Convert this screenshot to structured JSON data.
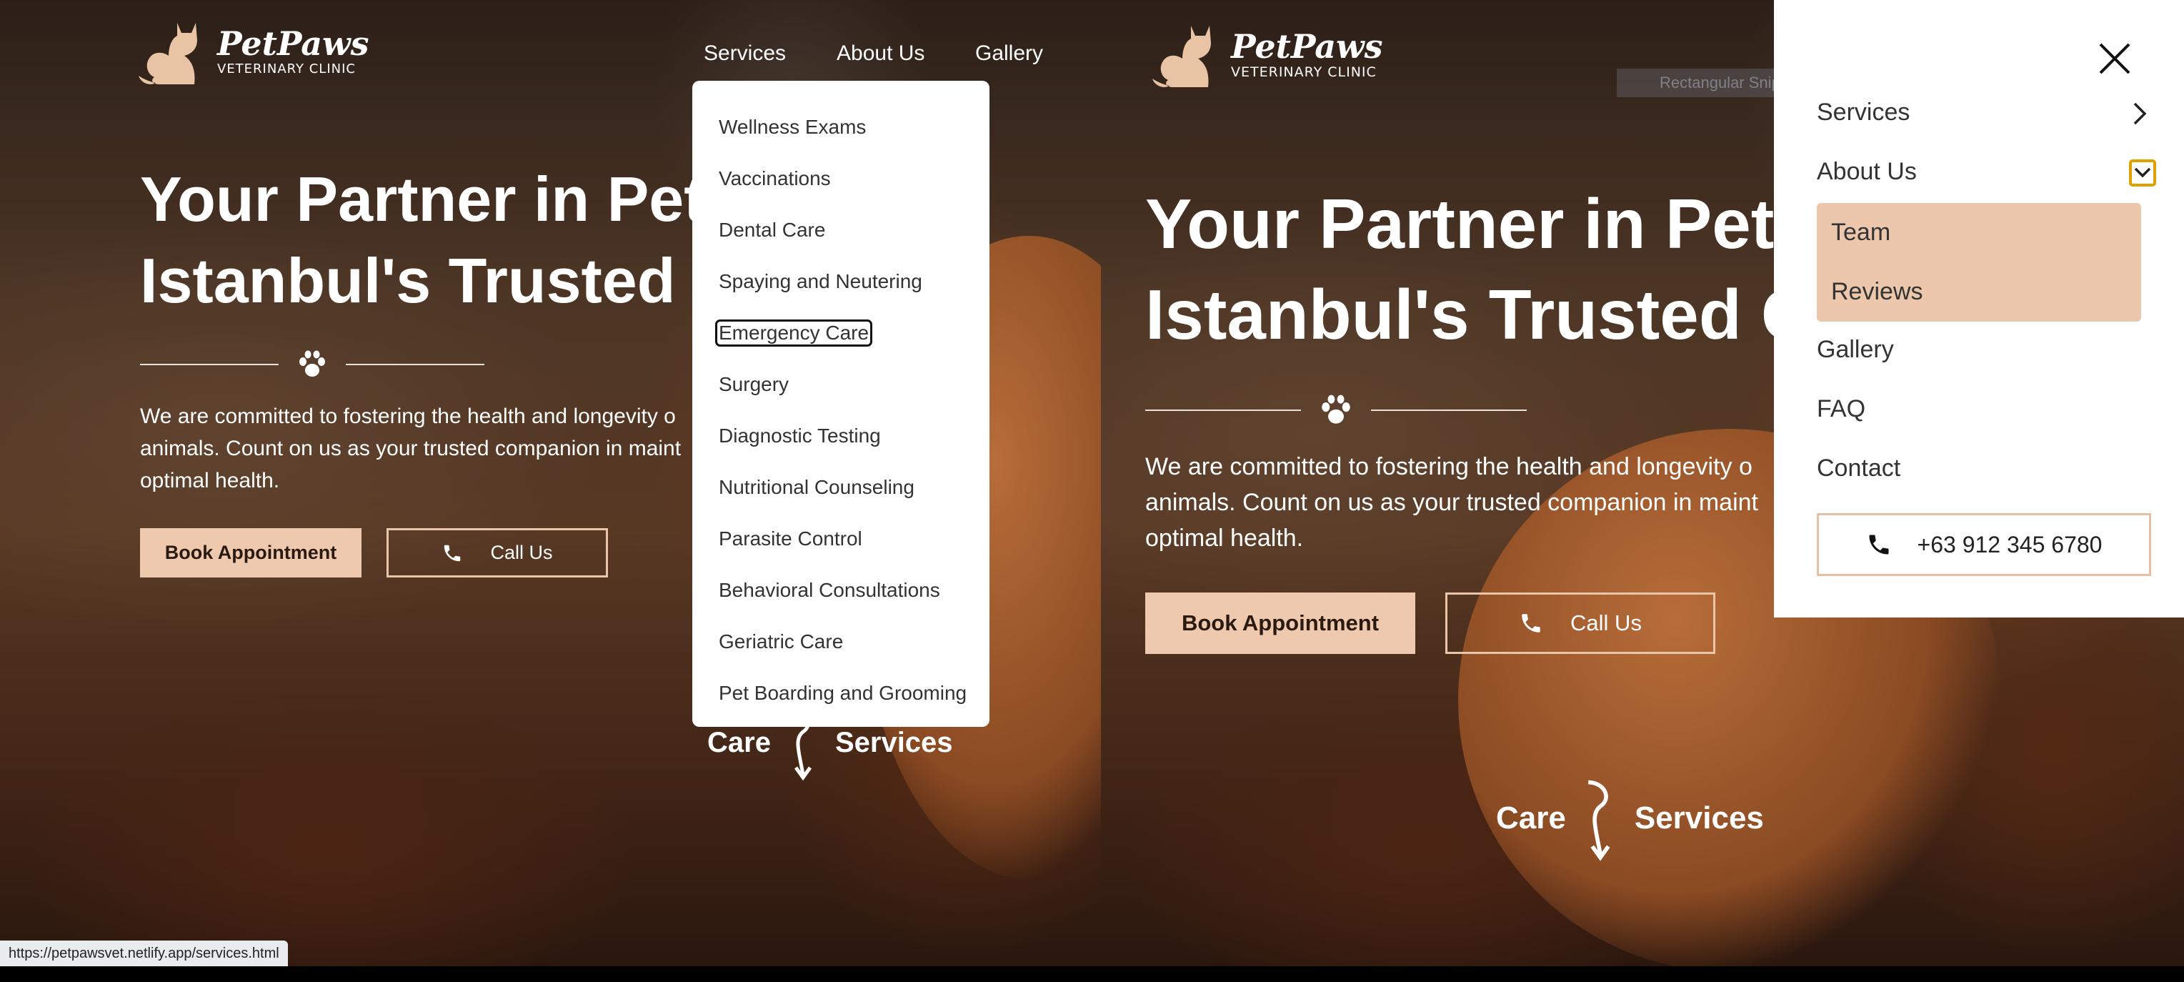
{
  "brand": {
    "name": "PetPaws",
    "subtitle": "VETERINARY CLINIC"
  },
  "nav": {
    "services": "Services",
    "about": "About Us",
    "gallery": "Gallery"
  },
  "hero": {
    "title_left": "Your Partner in Pet\nIstanbul's Trusted C",
    "title_right": "Your Partner in Pet\nIstanbul's Trusted C",
    "lede_left": "We are committed to fostering the health and longevity o\nanimals. Count on us as your trusted companion in maint\noptimal health.",
    "lede_right": "We are committed to fostering the health and longevity o\nanimals. Count on us as your trusted companion in maint\noptimal health.",
    "book_label": "Book Appointment",
    "call_label": "Call Us"
  },
  "care_services": {
    "care": "Care",
    "services": "Services"
  },
  "dropdown": {
    "items": [
      "Wellness Exams",
      "Vaccinations",
      "Dental Care",
      "Spaying and Neutering",
      "Emergency Care",
      "Surgery",
      "Diagnostic Testing",
      "Nutritional Counseling",
      "Parasite Control",
      "Behavioral Consultations",
      "Geriatric Care",
      "Pet Boarding and Grooming"
    ],
    "focused_index": 4
  },
  "status_bar": {
    "url": "https://petpawsvet.netlify.app/services.html"
  },
  "mobile_menu": {
    "services": "Services",
    "about": "About Us",
    "sub_items": [
      "Team",
      "Reviews"
    ],
    "gallery": "Gallery",
    "faq": "FAQ",
    "contact": "Contact",
    "phone": "+63 912 345 6780"
  },
  "ghost_label": "Rectangular Snip",
  "colors": {
    "accent": "#eec9ae",
    "checkbox": "#e0a100",
    "text_dark": "#333333"
  },
  "icons": [
    "cat-logo-icon",
    "paw-icon",
    "phone-icon",
    "close-icon",
    "chevron-right-icon",
    "checkbox-icon"
  ]
}
